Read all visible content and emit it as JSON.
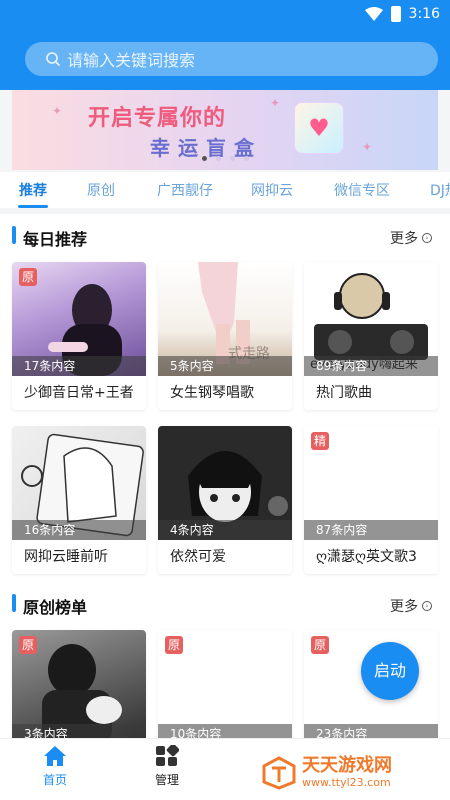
{
  "status": {
    "time": "3:16"
  },
  "search": {
    "placeholder": "请输入关键词搜索"
  },
  "banner": {
    "line1": "开启专属你的",
    "line2": "幸运盲盒"
  },
  "tabs": [
    "推荐",
    "原创",
    "广西靓仔",
    "网抑云",
    "微信专区",
    "DJ热"
  ],
  "daily": {
    "title": "每日推荐",
    "more": "更多",
    "items": [
      {
        "count": "17条内容",
        "name": "少御音日常+王者",
        "tag": "原"
      },
      {
        "count": "5条内容",
        "name": "女生钢琴唱歌",
        "tag": ""
      },
      {
        "count": "89条内容",
        "name": "热门歌曲",
        "tag": ""
      },
      {
        "count": "16条内容",
        "name": "网抑云睡前听",
        "tag": ""
      },
      {
        "count": "4条内容",
        "name": "依然可爱",
        "tag": ""
      },
      {
        "count": "87条内容",
        "name": "ღ潇瑟ღ英文歌3",
        "tag": "精"
      }
    ]
  },
  "original": {
    "title": "原创榜单",
    "more": "更多",
    "items": [
      {
        "count": "3条内容",
        "tag": "原"
      },
      {
        "count": "10条内容",
        "tag": "原"
      },
      {
        "count": "23条内容",
        "tag": "原"
      }
    ]
  },
  "fab": {
    "label": "启动"
  },
  "nav": {
    "home": "首页",
    "manage": "管理"
  },
  "watermark": {
    "name": "天天游戏网",
    "url": "www.ttyl23.com"
  },
  "colors": {
    "primary": "#1a8df2",
    "tag": "#e66060"
  }
}
